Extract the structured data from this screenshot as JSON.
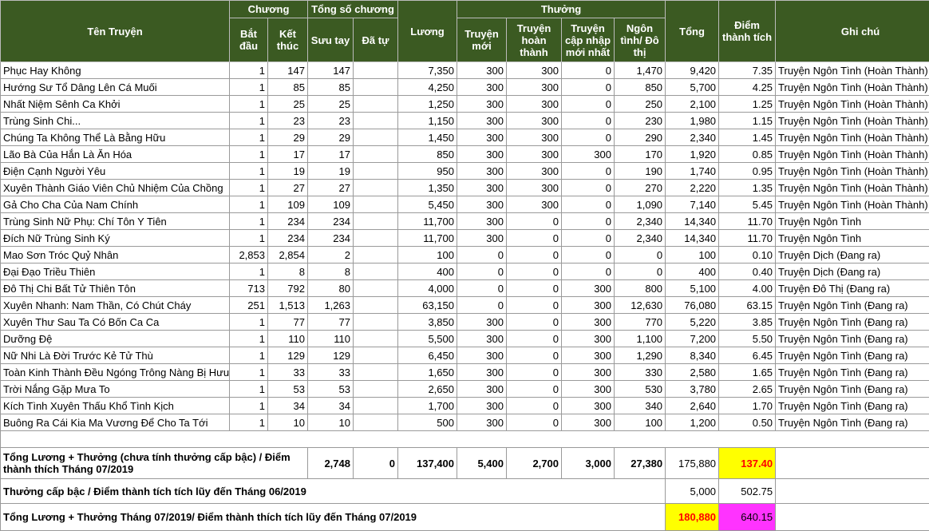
{
  "headers": {
    "ten_truyen": "Tên Truyện",
    "chuong": "Chương",
    "bat_dau": "Bắt đầu",
    "ket_thuc": "Kết thúc",
    "tong_so_chuong": "Tổng số chương",
    "suu_tay": "Sưu tay",
    "da_tu": "Đã tự",
    "luong": "Lương",
    "thuong": "Thưởng",
    "truyen_moi": "Truyện mới",
    "truyen_hoan_thanh": "Truyện hoàn thành",
    "truyen_cap_nhap": "Truyện cập nhập mới nhất",
    "ngon_tinh": "Ngôn tình/ Đô thị",
    "tong": "Tổng",
    "diem": "Điểm thành tích",
    "ghi_chu": "Ghi chú"
  },
  "rows": [
    {
      "name": "Phục Hay Không",
      "start": "1",
      "end": "147",
      "suu": "147",
      "tu": "",
      "luong": "7,350",
      "moi": "300",
      "hoan": "300",
      "capnhap": "0",
      "ngon": "1,470",
      "tong": "9,420",
      "diem": "7.35",
      "note": "Truyện Ngôn Tình (Hoàn Thành)"
    },
    {
      "name": "Hướng Sư Tổ Dâng Lên Cá Muối",
      "start": "1",
      "end": "85",
      "suu": "85",
      "tu": "",
      "luong": "4,250",
      "moi": "300",
      "hoan": "300",
      "capnhap": "0",
      "ngon": "850",
      "tong": "5,700",
      "diem": "4.25",
      "note": "Truyện Ngôn Tình (Hoàn Thành)"
    },
    {
      "name": "Nhất Niệm Sênh Ca Khởi",
      "start": "1",
      "end": "25",
      "suu": "25",
      "tu": "",
      "luong": "1,250",
      "moi": "300",
      "hoan": "300",
      "capnhap": "0",
      "ngon": "250",
      "tong": "2,100",
      "diem": "1.25",
      "note": "Truyện Ngôn Tình (Hoàn Thành)"
    },
    {
      "name": "Trùng Sinh Chi...",
      "start": "1",
      "end": "23",
      "suu": "23",
      "tu": "",
      "luong": "1,150",
      "moi": "300",
      "hoan": "300",
      "capnhap": "0",
      "ngon": "230",
      "tong": "1,980",
      "diem": "1.15",
      "note": "Truyện Ngôn Tình (Hoàn Thành)"
    },
    {
      "name": "Chúng Ta Không Thể Là Bằng Hữu",
      "start": "1",
      "end": "29",
      "suu": "29",
      "tu": "",
      "luong": "1,450",
      "moi": "300",
      "hoan": "300",
      "capnhap": "0",
      "ngon": "290",
      "tong": "2,340",
      "diem": "1.45",
      "note": "Truyện Ngôn Tình (Hoàn Thành)"
    },
    {
      "name": "Lão Bà Của Hắn Là Ăn Hóa",
      "start": "1",
      "end": "17",
      "suu": "17",
      "tu": "",
      "luong": "850",
      "moi": "300",
      "hoan": "300",
      "capnhap": "300",
      "ngon": "170",
      "tong": "1,920",
      "diem": "0.85",
      "note": "Truyện Ngôn Tình (Hoàn Thành)"
    },
    {
      "name": "Điện Cạnh Người Yêu",
      "start": "1",
      "end": "19",
      "suu": "19",
      "tu": "",
      "luong": "950",
      "moi": "300",
      "hoan": "300",
      "capnhap": "0",
      "ngon": "190",
      "tong": "1,740",
      "diem": "0.95",
      "note": "Truyện Ngôn Tình (Hoàn Thành)"
    },
    {
      "name": "Xuyên Thành Giáo Viên Chủ Nhiệm Của Chồng",
      "start": "1",
      "end": "27",
      "suu": "27",
      "tu": "",
      "luong": "1,350",
      "moi": "300",
      "hoan": "300",
      "capnhap": "0",
      "ngon": "270",
      "tong": "2,220",
      "diem": "1.35",
      "note": "Truyện Ngôn Tình (Hoàn Thành)"
    },
    {
      "name": "Gả Cho Cha Của Nam Chính",
      "start": "1",
      "end": "109",
      "suu": "109",
      "tu": "",
      "luong": "5,450",
      "moi": "300",
      "hoan": "300",
      "capnhap": "0",
      "ngon": "1,090",
      "tong": "7,140",
      "diem": "5.45",
      "note": "Truyện Ngôn Tình (Hoàn Thành)"
    },
    {
      "name": "Trùng Sinh Nữ Phụ: Chí Tôn Y Tiên",
      "start": "1",
      "end": "234",
      "suu": "234",
      "tu": "",
      "luong": "11,700",
      "moi": "300",
      "hoan": "0",
      "capnhap": "0",
      "ngon": "2,340",
      "tong": "14,340",
      "diem": "11.70",
      "note": "Truyện Ngôn Tình"
    },
    {
      "name": "Đích Nữ Trùng Sinh Ký",
      "start": "1",
      "end": "234",
      "suu": "234",
      "tu": "",
      "luong": "11,700",
      "moi": "300",
      "hoan": "0",
      "capnhap": "0",
      "ngon": "2,340",
      "tong": "14,340",
      "diem": "11.70",
      "note": "Truyện Ngôn Tình"
    },
    {
      "name": "Mao Sơn Tróc Quỷ Nhân",
      "start": "2,853",
      "end": "2,854",
      "suu": "2",
      "tu": "",
      "luong": "100",
      "moi": "0",
      "hoan": "0",
      "capnhap": "0",
      "ngon": "0",
      "tong": "100",
      "diem": "0.10",
      "note": "Truyện Dịch (Đang ra)"
    },
    {
      "name": "Đại Đạo Triều Thiên",
      "start": "1",
      "end": "8",
      "suu": "8",
      "tu": "",
      "luong": "400",
      "moi": "0",
      "hoan": "0",
      "capnhap": "0",
      "ngon": "0",
      "tong": "400",
      "diem": "0.40",
      "note": "Truyện Dịch (Đang ra)"
    },
    {
      "name": "Đô Thị Chi Bất Tử Thiên Tôn",
      "start": "713",
      "end": "792",
      "suu": "80",
      "tu": "",
      "luong": "4,000",
      "moi": "0",
      "hoan": "0",
      "capnhap": "300",
      "ngon": "800",
      "tong": "5,100",
      "diem": "4.00",
      "note": "Truyện Đô Thị (Đang ra)"
    },
    {
      "name": "Xuyên Nhanh: Nam Thần, Có Chút Cháy",
      "start": "251",
      "end": "1,513",
      "suu": "1,263",
      "tu": "",
      "luong": "63,150",
      "moi": "0",
      "hoan": "0",
      "capnhap": "300",
      "ngon": "12,630",
      "tong": "76,080",
      "diem": "63.15",
      "note": "Truyện Ngôn Tình (Đang ra)"
    },
    {
      "name": "Xuyên Thư Sau Ta Có Bốn Ca Ca",
      "start": "1",
      "end": "77",
      "suu": "77",
      "tu": "",
      "luong": "3,850",
      "moi": "300",
      "hoan": "0",
      "capnhap": "300",
      "ngon": "770",
      "tong": "5,220",
      "diem": "3.85",
      "note": "Truyện Ngôn Tình (Đang ra)"
    },
    {
      "name": "Dưỡng Đệ",
      "start": "1",
      "end": "110",
      "suu": "110",
      "tu": "",
      "luong": "5,500",
      "moi": "300",
      "hoan": "0",
      "capnhap": "300",
      "ngon": "1,100",
      "tong": "7,200",
      "diem": "5.50",
      "note": "Truyện Ngôn Tình (Đang ra)"
    },
    {
      "name": "Nữ Nhi Là Đời Trước Kẻ Tử Thù",
      "start": "1",
      "end": "129",
      "suu": "129",
      "tu": "",
      "luong": "6,450",
      "moi": "300",
      "hoan": "0",
      "capnhap": "300",
      "ngon": "1,290",
      "tong": "8,340",
      "diem": "6.45",
      "note": "Truyện Ngôn Tình (Đang ra)"
    },
    {
      "name": "Toàn Kinh Thành Đều Ngóng Trông Nàng Bị Hưu",
      "start": "1",
      "end": "33",
      "suu": "33",
      "tu": "",
      "luong": "1,650",
      "moi": "300",
      "hoan": "0",
      "capnhap": "300",
      "ngon": "330",
      "tong": "2,580",
      "diem": "1.65",
      "note": "Truyện Ngôn Tình (Đang ra)"
    },
    {
      "name": "Trời Nắng Gặp Mưa To",
      "start": "1",
      "end": "53",
      "suu": "53",
      "tu": "",
      "luong": "2,650",
      "moi": "300",
      "hoan": "0",
      "capnhap": "300",
      "ngon": "530",
      "tong": "3,780",
      "diem": "2.65",
      "note": "Truyện Ngôn Tình (Đang ra)"
    },
    {
      "name": "Kích Tình Xuyên Thấu Khổ Tình Kịch",
      "start": "1",
      "end": "34",
      "suu": "34",
      "tu": "",
      "luong": "1,700",
      "moi": "300",
      "hoan": "0",
      "capnhap": "300",
      "ngon": "340",
      "tong": "2,640",
      "diem": "1.70",
      "note": "Truyện Ngôn Tình (Đang ra)"
    },
    {
      "name": "Buông Ra Cái Kia Ma Vương Để Cho Ta Tới",
      "start": "1",
      "end": "10",
      "suu": "10",
      "tu": "",
      "luong": "500",
      "moi": "300",
      "hoan": "0",
      "capnhap": "300",
      "ngon": "100",
      "tong": "1,200",
      "diem": "0.50",
      "note": "Truyện Ngôn Tình (Đang ra)"
    }
  ],
  "summary": {
    "row1": {
      "label": "Tổng Lương + Thưởng (chưa tính thưởng cấp bậc) / Điểm thành thích Tháng 07/2019",
      "suu": "2,748",
      "tu": "0",
      "luong": "137,400",
      "moi": "5,400",
      "hoan": "2,700",
      "capnhap": "3,000",
      "ngon": "27,380",
      "tong": "175,880",
      "diem": "137.40"
    },
    "row2": {
      "label": "Thưởng cấp bậc / Điểm thành tích tích lũy đến Tháng 06/2019",
      "tong": "5,000",
      "diem": "502.75"
    },
    "row3": {
      "label": "Tổng Lương + Thưởng Tháng 07/2019/ Điểm thành thích tích lũy đến Tháng 07/2019",
      "tong": "180,880",
      "diem": "640.15"
    }
  },
  "colors": {
    "header_bg": "#3b5a22",
    "highlight_yellow": "#ffff00",
    "highlight_magenta": "#ff33ff",
    "red_text": "#ff0000"
  }
}
